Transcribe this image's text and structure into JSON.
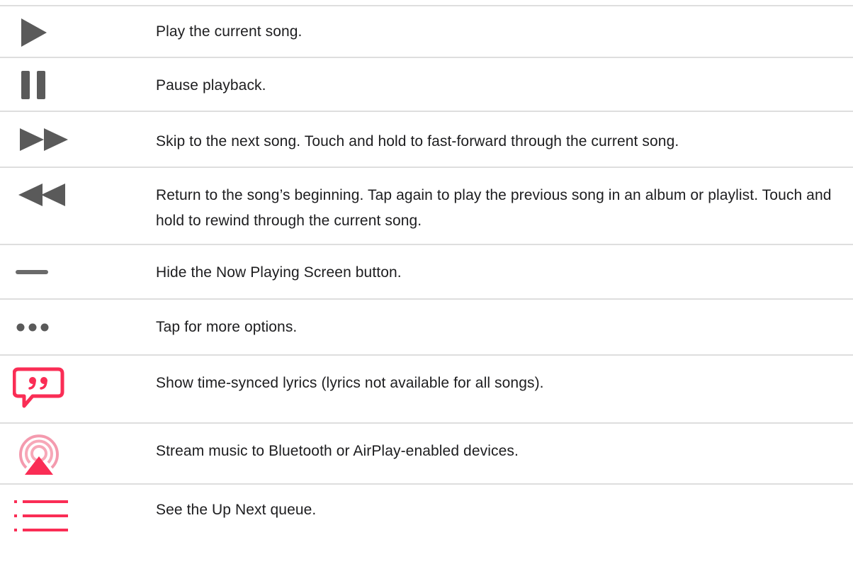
{
  "rows": [
    {
      "icon": "play-icon",
      "text": "Play the current song."
    },
    {
      "icon": "pause-icon",
      "text": "Pause playback."
    },
    {
      "icon": "fast-forward-icon",
      "text": "Skip to the next song. Touch and hold to fast-forward through the current song."
    },
    {
      "icon": "rewind-icon",
      "text": "Return to the song’s beginning. Tap again to play the previous song in an album or playlist. Touch and hold to rewind through the current song."
    },
    {
      "icon": "minus-handle-icon",
      "text": "Hide the Now Playing Screen button."
    },
    {
      "icon": "more-options-icon",
      "text": "Tap for more options."
    },
    {
      "icon": "lyrics-icon",
      "text": "Show time-synced lyrics (lyrics not available for all songs)."
    },
    {
      "icon": "airplay-icon",
      "text": "Stream music to Bluetooth or AirPlay-enabled devices."
    },
    {
      "icon": "up-next-queue-icon",
      "text": "See the Up Next queue."
    }
  ],
  "colors": {
    "icon_gray": "#5a5a5a",
    "accent_pink": "#fa2d55",
    "divider": "#dedede",
    "text": "#1d1d1f"
  }
}
